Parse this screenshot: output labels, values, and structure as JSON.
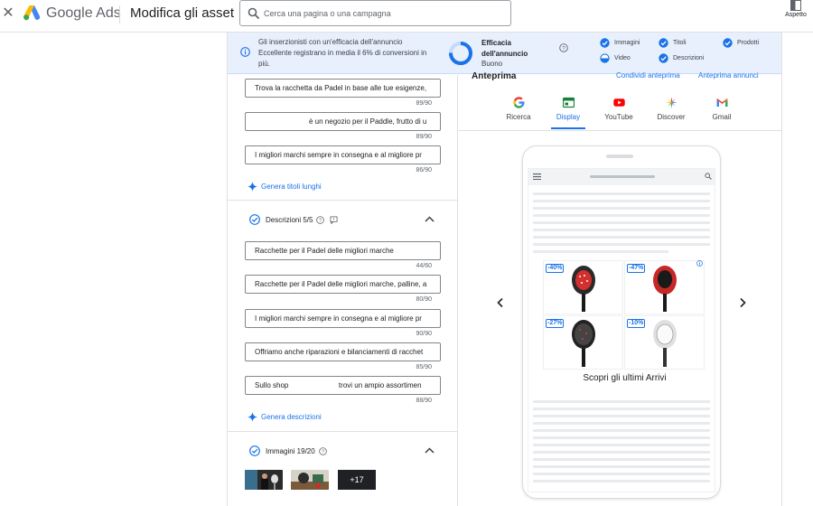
{
  "topbar": {
    "brand": "Google Ads",
    "page_title": "Modifica gli asset",
    "search_placeholder": "Cerca una pagina o una campagna",
    "appearance_label": "Aspetto"
  },
  "banner": {
    "message": "Gli inserzionisti con un'efficacia dell'annuncio Eccellente registrano in media il 6% di conversioni in più.",
    "effectiveness_title": "Efficacia dell'annuncio",
    "effectiveness_status": "Buono",
    "checks": [
      "Immagini",
      "Titoli",
      "Prodotti",
      "Video",
      "Descrizioni"
    ]
  },
  "headlines": {
    "fields": [
      {
        "value": "Trova la racchetta da Padel in base alle tue esigenze,",
        "count": "89/90"
      },
      {
        "value": "è un negozio per il Paddle, frutto di u",
        "count": "89/90"
      },
      {
        "value": "I migliori marchi sempre in consegna e al migliore pr",
        "count": "86/90"
      }
    ],
    "generate_label": "Genera titoli lunghi"
  },
  "descriptions": {
    "title": "Descrizioni 5/5",
    "fields": [
      {
        "value": "Racchette per il Padel delle migliori marche",
        "count": "44/60"
      },
      {
        "value": "Racchette per il Padel delle migliori marche, palline, a",
        "count": "80/90"
      },
      {
        "value": "I migliori marchi sempre in consegna e al migliore pr",
        "count": "90/90"
      },
      {
        "value": "Offriamo anche riparazioni e bilanciamenti di racchet",
        "count": "85/90"
      },
      {
        "value": "Sullo shop                         trovi un ampio assortimen",
        "count": "88/90"
      }
    ],
    "generate_label": "Genera descrizioni"
  },
  "images": {
    "title": "Immagini 19/20",
    "more_label": "+17"
  },
  "preview": {
    "title": "Anteprima",
    "share_label": "Condividi anteprima",
    "ad_preview_label": "Anteprima annunci",
    "tabs": [
      "Ricerca",
      "Display",
      "YouTube",
      "Discover",
      "Gmail"
    ],
    "active_tab": "Display",
    "discounts": [
      "-40%",
      "-47%",
      "-27%",
      "-10%"
    ],
    "ad_caption": "Scopri gli ultimi Arrivi"
  },
  "colors": {
    "accent": "#1a73e8",
    "banner_bg": "#e8f0fe"
  }
}
